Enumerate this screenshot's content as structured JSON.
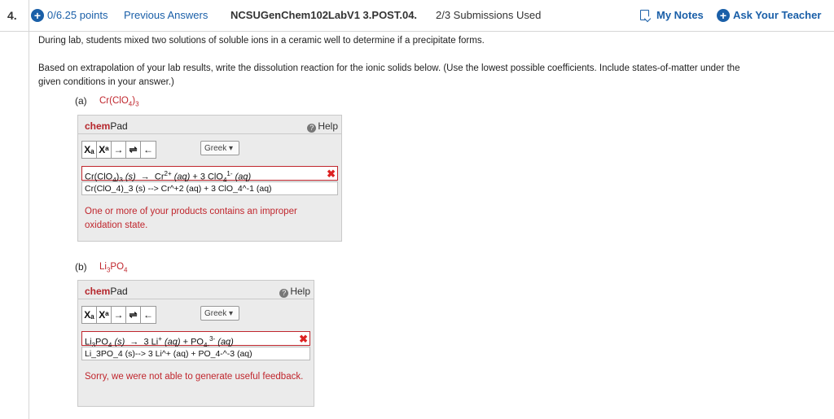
{
  "header": {
    "question_number": "4.",
    "points": "0/6.25 points",
    "previous_answers": "Previous Answers",
    "assignment": "NCSUGenChem102LabV1 3.POST.04.",
    "submissions": "2/3 Submissions Used",
    "my_notes": "My Notes",
    "ask_teacher": "Ask Your Teacher"
  },
  "intro": "During lab, students mixed two solutions of soluble ions in a ceramic well to determine if a precipitate forms.",
  "instructions_line1": "Based on extrapolation of your lab results, write the dissolution reaction for the ionic solids below. (Use the lowest possible coefficients. Include states-of-matter under the",
  "instructions_line2": "given conditions in your answer.)",
  "parts": [
    {
      "label": "(a)",
      "compound": "Cr(ClO4)3",
      "chempad_title": "Pad",
      "chempad_brand": "chem",
      "help": "Help",
      "greek": "Greek",
      "raw_answer": "Cr(ClO_4)_3 (s) --> Cr^+2 (aq) + 3 ClO_4^-1 (aq)",
      "feedback": "One or more of your products contains an improper oxidation state."
    },
    {
      "label": "(b)",
      "compound": "Li3PO4",
      "chempad_title": "Pad",
      "chempad_brand": "chem",
      "help": "Help",
      "greek": "Greek",
      "raw_answer": "Li_3PO_4 (s)--> 3 Li^+ (aq) + PO_4-^-3 (aq)",
      "feedback": "Sorry, we were not able to generate useful feedback."
    }
  ],
  "toolbar": {
    "subscript": "Xₐ",
    "superscript": "Xᵃ",
    "arrow": "→",
    "equilibrium": "⇌",
    "back_arrow": "←"
  },
  "colors": {
    "link": "#1a5fa8",
    "error": "#c0262d"
  }
}
